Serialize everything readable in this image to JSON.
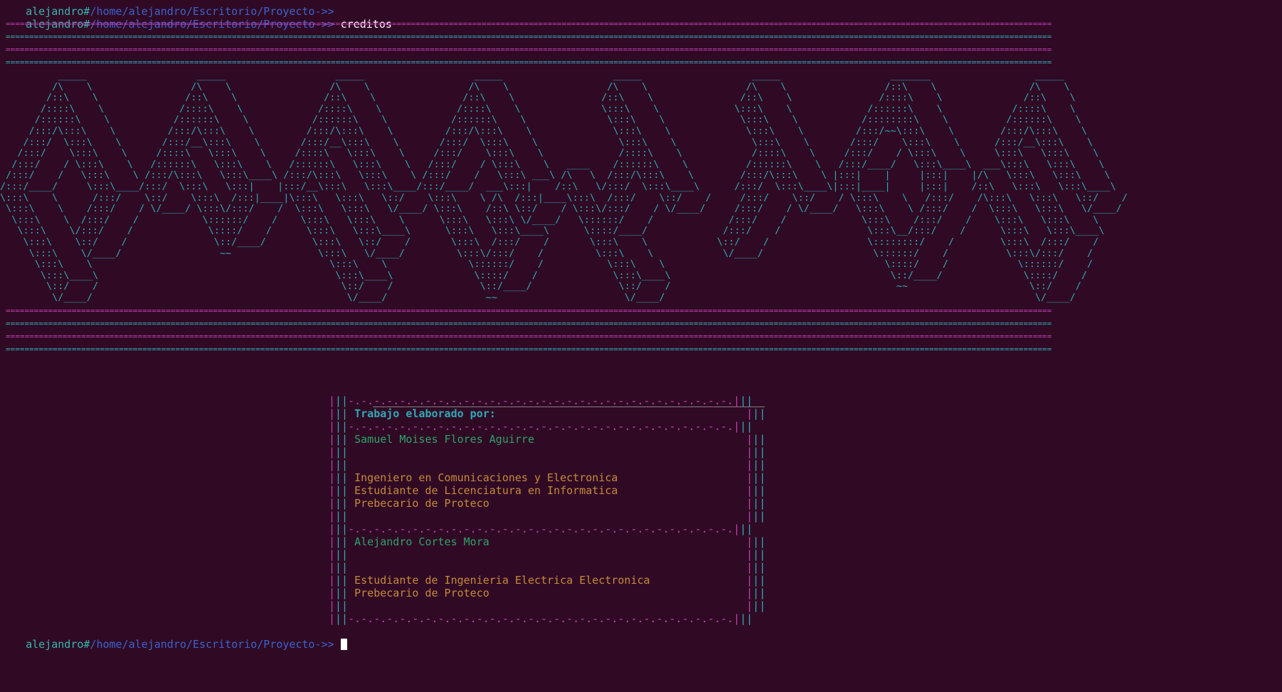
{
  "prompt": {
    "user": "alejandro#",
    "path": "/home/alejandro/Escritorio/Proyecto->> "
  },
  "history": [
    {
      "command": ""
    },
    {
      "command": "creditos"
    }
  ],
  "rules": [
    "==============================================================================================================================================================================================================================",
    "==============================================================================================================================================================================================================================",
    "==============================================================================================================================================================================================================================",
    "=============================================================================================================================================================================================================================="
  ],
  "ascii_art": [
    "          _____                   _____                   _____                   _____                   _____                   _____                   _______                  _____          ",
    "         /\\    \\                 /\\    \\                 /\\    \\                 /\\    \\                 /\\    \\                 /\\    \\                 /::\\    \\                /\\    \\         ",
    "        /::\\    \\               /::\\    \\               /::\\    \\               /::\\    \\               /::\\    \\               /::\\    \\               /::::\\    \\              /::\\    \\        ",
    "       /::::\\    \\             /::::\\    \\             /::::\\    \\             /::::\\    \\              \\:::\\    \\             \\:::\\    \\             /::::::\\    \\            /::::\\    \\       ",
    "      /::::::\\    \\           /::::::\\    \\           /::::::\\    \\           /::::::\\    \\              \\:::\\    \\             \\:::\\    \\           /::::::::\\    \\          /::::::\\    \\      ",
    "     /:::/\\:::\\    \\         /:::/\\:::\\    \\         /:::/\\:::\\    \\         /:::/\\:::\\    \\              \\:::\\    \\             \\:::\\    \\         /:::/~~\\:::\\    \\        /:::/\\:::\\    \\     ",
    "    /:::/  \\:::\\    \\       /:::/__\\:::\\    \\       /:::/__\\:::\\    \\       /:::/  \\:::\\    \\              \\:::\\    \\             \\:::\\    \\       /:::/    \\:::\\    \\      /:::/__\\:::\\    \\    ",
    "   /:::/    \\:::\\    \\     /::::\\   \\:::\\    \\     /::::\\   \\:::\\    \\     /:::/    \\:::\\    \\             /::::\\    \\            /::::\\    \\     /:::/    / \\:::\\    \\     \\:::\\   \\:::\\    \\   ",
    "  /:::/    / \\:::\\    \\   /::::::\\   \\:::\\    \\   /::::::\\   \\:::\\    \\   /:::/    / \\:::\\    \\   ____    /::::::\\    \\          /::::::\\    \\   /:::/____/   \\:::\\____\\  ___\\:::\\   \\:::\\    \\  ",
    " /:::/    /   \\:::\\    \\ /:::/\\:::\\   \\:::\\____\\ /:::/\\:::\\   \\:::\\    \\ /:::/    /   \\:::\\ ___\\ /\\   \\  /:::/\\:::\\    \\        /:::/\\:::\\    \\ |:::|    |     |:::|    |/\\   \\:::\\   \\:::\\    \\ ",
    "/:::/____/     \\:::\\____/:::/  \\:::\\   \\:::|    |:::/__\\:::\\   \\:::\\____/:::/____/  ___\\:::|    /::\\   \\/:::/  \\:::\\____\\      /:::/  \\:::\\____\\|:::|____|     |:::|    /::\\   \\:::\\   \\:::\\____\\",
    "\\:::\\    \\      /:::/    \\::/    \\:::\\  /:::|____|\\:::\\   \\:::\\   \\::/    \\:::\\    \\ /\\  /:::|____\\:::\\  /:::/    \\::/    /     /:::/    \\::/    / \\:::\\    \\   /:::/    /\\:::\\   \\:::\\   \\::/    /",
    " \\:::\\    \\    /:::/    / \\/____/ \\:::\\/:::/    /  \\:::\\   \\:::\\   \\/____/ \\:::\\    /::\\ \\::/    / \\:::\\/:::/    / \\/____/     /:::/    / \\/____/   \\:::\\    \\ /:::/    /  \\:::\\   \\:::\\   \\/____/ ",
    "  \\:::\\    \\  /:::/    /           \\::::::/    /    \\:::\\   \\:::\\    \\      \\:::\\   \\:::\\ \\/____/   \\::::::/    /             /:::/    /             \\:::\\    /:::/    /    \\:::\\   \\:::\\    \\     ",
    "   \\:::\\    \\/:::/    /             \\::::/    /      \\:::\\   \\:::\\____\\      \\:::\\   \\:::\\____\\      \\::::/____/             /:::/    /               \\:::\\__/:::/    /      \\:::\\   \\:::\\____\\    ",
    "    \\:::\\    \\::/    /               \\::/____/        \\:::\\   \\::/    /       \\:::\\  /:::/    /       \\:::\\    \\            \\::/    /                 \\::::::::/    /        \\:::\\  /:::/    /    ",
    "     \\:::\\    \\/____/                 ~~               \\:::\\   \\/____/         \\:::\\/:::/    /         \\:::\\    \\            \\/____/                   \\::::::/    /          \\:::\\/:::/    /     ",
    "      \\:::\\    \\                                         \\:::\\    \\              \\::::::/    /           \\:::\\    \\                                      \\::::/    /            \\::::::/    /      ",
    "       \\:::\\____\\                                         \\:::\\____\\              \\::::/    /             \\:::\\____\\                                      \\::/____/              \\::::/    /       ",
    "        \\::/    /                                          \\::/    /               \\::/____/               \\::/    /                                       ~~                     \\::/    /        ",
    "         \\/____/                                            \\/____/                 ~~                      \\/____/                                                                \\/____/         "
  ],
  "credits_box": {
    "top": "_____________________________________________________________",
    "divider": "-.-.-.-.-.-.-.-.-.-.-.-.-.-.-.-.-.-.-.-.-.-.-.-.-.-.-.-.-.-.",
    "title": "Trabajo elaborado por:",
    "people": [
      {
        "name": "Samuel Moises Flores Aguirre",
        "details": [
          "Ingeniero en Comunicaciones y Electronica",
          "Estudiante de Licenciatura en Informatica",
          "Prebecario de Proteco"
        ]
      },
      {
        "name": "Alejandro Cortes Mora",
        "details": [
          "Estudiante de Ingenieria Electrica Electronica",
          "Prebecario de Proteco"
        ]
      }
    ]
  },
  "colors": {
    "background": "#300a24",
    "user": "#34b6b0",
    "path": "#3a63d0",
    "magenta": "#c13fb5",
    "cyan": "#2fa9b7",
    "name": "#2da36b",
    "info": "#c68a3a"
  }
}
